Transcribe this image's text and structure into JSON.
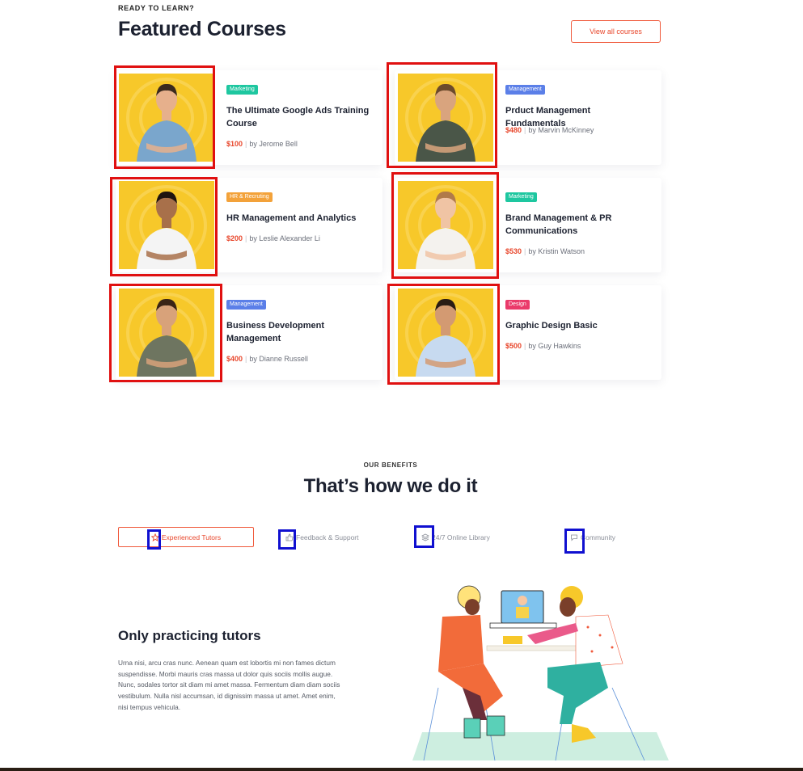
{
  "featured": {
    "eyebrow": "READY TO LEARN?",
    "title": "Featured Courses",
    "view_all_label": "View all courses"
  },
  "courses": [
    {
      "tag": "Marketing",
      "tag_color": "#1ec7a0",
      "title": "The Ultimate Google Ads Training Course",
      "price": "$100",
      "author": "by Jerome Bell",
      "shirt": "#7aa6cc",
      "skin": "#e6b08c",
      "hair": "#3a2a1e"
    },
    {
      "tag": "Management",
      "tag_color": "#5b7fe8",
      "title": "Prduct Management Fundamentals",
      "price": "$480",
      "author": "by Marvin McKinney",
      "shirt": "#4a5648",
      "skin": "#d9a47e",
      "hair": "#6b4a2c"
    },
    {
      "tag": "HR & Recruting",
      "tag_color": "#f3a23a",
      "title": "HR  Management and Analytics",
      "price": "$200",
      "author": "by Leslie Alexander Li",
      "shirt": "#f4f4f4",
      "skin": "#a8704a",
      "hair": "#1e1410"
    },
    {
      "tag": "Marketing",
      "tag_color": "#1ec7a0",
      "title": "Brand Management & PR Communications",
      "price": "$530",
      "author": "by Kristin Watson",
      "shirt": "#f4f2ee",
      "skin": "#f0c4a4",
      "hair": "#b07a4a"
    },
    {
      "tag": "Management",
      "tag_color": "#5b7fe8",
      "title": "Business Development Management",
      "price": "$400",
      "author": "by Dianne Russell",
      "shirt": "#6e7560",
      "skin": "#d8a27a",
      "hair": "#3a2416"
    },
    {
      "tag": "Design",
      "tag_color": "#ea3a6a",
      "title": "Graphic Design Basic",
      "price": "$500",
      "author": "by Guy Hawkins",
      "shirt": "#c7daf0",
      "skin": "#d39a72",
      "hair": "#2a1c14"
    }
  ],
  "benefits": {
    "eyebrow": "OUR BENEFITS",
    "title": "That’s how we do it",
    "tabs": [
      {
        "label": "Experienced Tutors",
        "icon": "star-icon",
        "active": true
      },
      {
        "label": "Feedback & Support",
        "icon": "thumbs-up-icon",
        "active": false
      },
      {
        "label": "24/7 Online Library",
        "icon": "layers-icon",
        "active": false
      },
      {
        "label": "Community",
        "icon": "chat-icon",
        "active": false
      }
    ],
    "panel": {
      "heading": "Only practicing tutors",
      "body": "Urna nisi, arcu cras nunc. Aenean quam est lobortis mi non fames dictum suspendisse. Morbi mauris cras massa ut dolor quis sociis mollis augue. Nunc, sodales tortor sit diam mi amet massa. Fermentum diam diam sociis vestibulum. Nulla nisl accumsan, id dignissim massa ut amet. Amet enim, nisi tempus vehicula."
    }
  },
  "colors": {
    "accent": "#e8472c",
    "thumb_bg": "#f7c82a",
    "highlight_red": "#e01010",
    "highlight_blue": "#1010d0"
  }
}
